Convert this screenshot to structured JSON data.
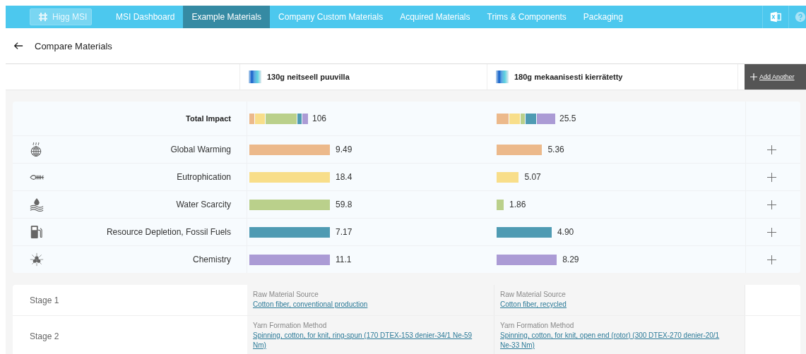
{
  "nav": {
    "logo": "Higg MSI",
    "tabs": [
      {
        "label": "MSI Dashboard",
        "selected": false
      },
      {
        "label": "Example Materials",
        "selected": true
      },
      {
        "label": "Company Custom Materials",
        "selected": false
      },
      {
        "label": "Acquired Materials",
        "selected": false
      },
      {
        "label": "Trims & Components",
        "selected": false
      },
      {
        "label": "Packaging",
        "selected": false
      }
    ]
  },
  "page_title": "Compare Materials",
  "materials": [
    {
      "name": "130g neitseell puuvilla"
    },
    {
      "name": "180g mekaanisesti kierrätetty"
    }
  ],
  "add_button": "Add Another",
  "total_impact": {
    "label": "Total Impact",
    "cells": [
      {
        "value": "106"
      },
      {
        "value": "25.5"
      }
    ]
  },
  "impacts": [
    {
      "name": "Global Warming",
      "color": "#ecb98b",
      "cells": [
        {
          "value": "9.49"
        },
        {
          "value": "5.36"
        }
      ]
    },
    {
      "name": "Eutrophication",
      "color": "#f8de8a",
      "cells": [
        {
          "value": "18.4"
        },
        {
          "value": "5.07"
        }
      ]
    },
    {
      "name": "Water Scarcity",
      "color": "#bad08b",
      "cells": [
        {
          "value": "59.8"
        },
        {
          "value": "1.86"
        }
      ]
    },
    {
      "name": "Resource Depletion, Fossil Fuels",
      "color": "#4f9bb3",
      "cells": [
        {
          "value": "7.17"
        },
        {
          "value": "4.90"
        }
      ]
    },
    {
      "name": "Chemistry",
      "color": "#ab9bd5",
      "cells": [
        {
          "value": "11.1"
        },
        {
          "value": "8.29"
        }
      ]
    }
  ],
  "stages": [
    {
      "label": "Stage 1",
      "cells": [
        {
          "heading": "Raw Material Source",
          "link": "Cotton fiber, conventional production"
        },
        {
          "heading": "Raw Material Source",
          "link": "Cotton fiber, recycled"
        }
      ]
    },
    {
      "label": "Stage 2",
      "cells": [
        {
          "heading": "Yarn Formation Method",
          "link": "Spinning, cotton, for knit, ring-spun (170 DTEX-153 denier-34/1 Ne-59 Nm)"
        },
        {
          "heading": "Yarn Formation Method",
          "link": "Spinning, cotton, for knit, open end (rotor) (300 DTEX-270 denier-20/1 Ne-33 Nm)"
        }
      ]
    }
  ]
}
